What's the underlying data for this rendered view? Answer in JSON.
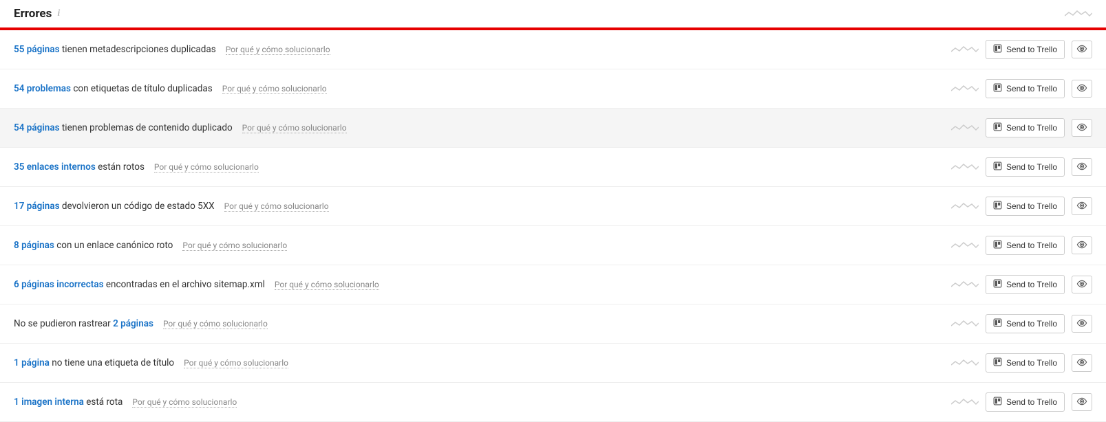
{
  "header": {
    "title": "Errores"
  },
  "common": {
    "fix_link": "Por qué y cómo solucionarlo",
    "send_to_trello": "Send to Trello"
  },
  "issues": [
    {
      "link_text": "55 páginas",
      "rest": " tienen metadescripciones duplicadas",
      "prefix": "",
      "highlight": false
    },
    {
      "link_text": "54 problemas",
      "rest": " con etiquetas de título duplicadas",
      "prefix": "",
      "highlight": false
    },
    {
      "link_text": "54 páginas",
      "rest": " tienen problemas de contenido duplicado",
      "prefix": "",
      "highlight": true
    },
    {
      "link_text": "35 enlaces internos",
      "rest": " están rotos",
      "prefix": "",
      "highlight": false
    },
    {
      "link_text": "17 páginas",
      "rest": " devolvieron un código de estado 5XX",
      "prefix": "",
      "highlight": false
    },
    {
      "link_text": "8 páginas",
      "rest": " con un enlace canónico roto",
      "prefix": "",
      "highlight": false
    },
    {
      "link_text": "6 páginas incorrectas",
      "rest": " encontradas en el archivo sitemap.xml",
      "prefix": "",
      "highlight": false
    },
    {
      "link_text": "2 páginas",
      "rest": "",
      "prefix": "No se pudieron rastrear ",
      "highlight": false
    },
    {
      "link_text": "1 página",
      "rest": " no tiene una etiqueta de título",
      "prefix": "",
      "highlight": false
    },
    {
      "link_text": "1 imagen interna",
      "rest": " está rota",
      "prefix": "",
      "highlight": false
    }
  ]
}
